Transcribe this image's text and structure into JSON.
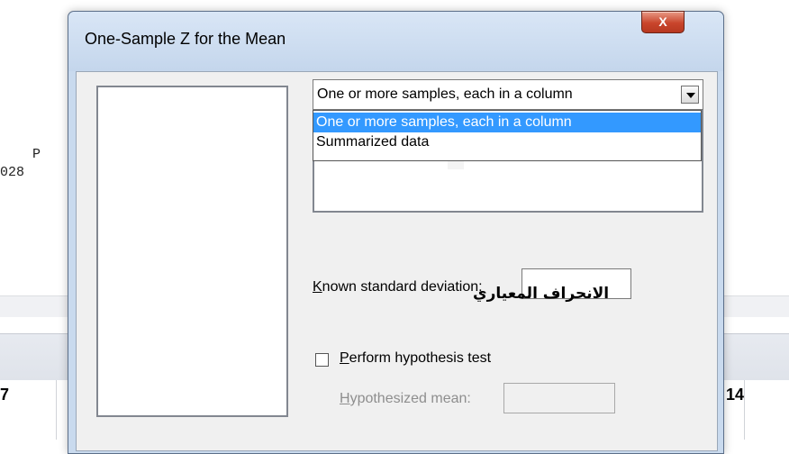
{
  "background": {
    "session_col_header": "P",
    "session_value": "028",
    "grid_left_value": "7",
    "grid_right_value": "14"
  },
  "dialog": {
    "title": "One-Sample Z for the Mean",
    "close_glyph": "X",
    "combo": {
      "selected": "One or more samples, each in a column",
      "options": [
        "One or more samples, each in a column",
        "Summarized data"
      ]
    },
    "known_sd": {
      "label_mnemonic": "K",
      "label_rest": "nown standard deviation:",
      "value": ""
    },
    "overlay_annotation": "الانحراف المعياري",
    "hypothesis": {
      "checked": false,
      "label_mnemonic": "P",
      "label_rest": "erform hypothesis test",
      "mean_label_mnemonic": "H",
      "mean_label_rest": "ypothesized mean:",
      "mean_value": ""
    }
  }
}
